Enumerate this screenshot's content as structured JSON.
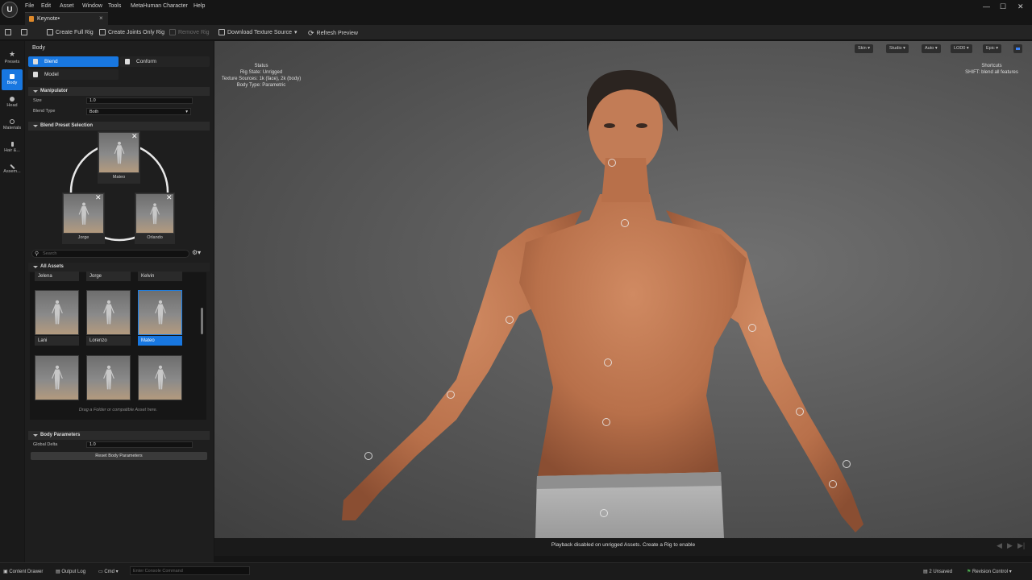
{
  "app": {
    "logo": "U"
  },
  "menu": [
    "File",
    "Edit",
    "Asset",
    "Window",
    "Tools",
    "MetaHuman Character",
    "Help"
  ],
  "tab": {
    "label": "Keynote•",
    "close": "×"
  },
  "toolbar": {
    "create_full_rig": "Create Full Rig",
    "create_joints_rig": "Create Joints Only Rig",
    "remove_rig": "Remove Rig",
    "download_texture": "Download Texture Source",
    "refresh_preview": "Refresh Preview"
  },
  "rail": [
    {
      "label": "Presets",
      "icon": "star-icon"
    },
    {
      "label": "Body",
      "icon": "body-icon",
      "active": true
    },
    {
      "label": "Head",
      "icon": "head-icon"
    },
    {
      "label": "Materials",
      "icon": "materials-icon"
    },
    {
      "label": "Hair &...",
      "icon": "hair-icon"
    },
    {
      "label": "Assem...",
      "icon": "hammer-icon"
    }
  ],
  "panel": {
    "title": "Body",
    "modes": {
      "blend": "Blend",
      "conform": "Conform",
      "model": "Model"
    },
    "manipulator": {
      "header": "Manipulator",
      "size_label": "Size",
      "size_value": "1.0",
      "blend_type_label": "Blend Type",
      "blend_type_value": "Both"
    },
    "blend_preset": {
      "header": "Blend Preset Selection",
      "cards": [
        "Mateo",
        "Jorge",
        "Orlando"
      ]
    },
    "search_placeholder": "Search",
    "all_assets": {
      "header": "All Assets",
      "top_row": [
        "Jelena",
        "Jorge",
        "Kelvin"
      ],
      "mid_row": [
        "Lani",
        "Lorenzo",
        "Mateo"
      ],
      "selected": "Mateo",
      "drag_hint": "Drag a Folder or compatible Asset here."
    },
    "body_params": {
      "header": "Body Parameters",
      "global_delta_label": "Global Delta",
      "global_delta_value": "1.0",
      "reset_button": "Reset Body Parameters"
    }
  },
  "viewport": {
    "buttons": {
      "skin": "Skin ▾",
      "studio": "Studio ▾",
      "auto": "Auto ▾",
      "lod": "LOD0 ▾",
      "epic": "Epic ▾"
    },
    "status": {
      "title": "Status",
      "rig_state": "Rig State: Unrigged",
      "texture_sources": "Texture Sources: 1k (face), 2k (body)",
      "body_type": "Body Type: Parametric"
    },
    "shortcuts": {
      "title": "Shortcuts",
      "hint": "SHIFT: blend all features"
    }
  },
  "playbar": {
    "message": "Playback disabled on unrigged Assets. Create a Rig to enable"
  },
  "statusbar": {
    "content_drawer": "Content Drawer",
    "output_log": "Output Log",
    "cmd": "Cmd ▾",
    "console_placeholder": "Enter Console Command",
    "unsaved": "2 Unsaved",
    "revision_control": "Revision Control ▾"
  }
}
